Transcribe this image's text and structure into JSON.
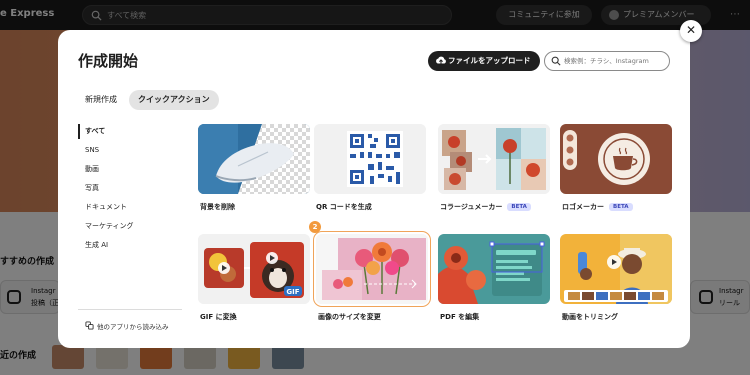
{
  "app": {
    "brand": "e Express",
    "search_placeholder": "すべて検索",
    "community_label": "コミュニティに参加",
    "premium_label": "プレミアムメンバー",
    "section_recommended": "すすめの作成",
    "section_recent": "近の作成",
    "bg_card_left": {
      "line1": "Instagr",
      "line2": "投稿（正"
    },
    "bg_card_right": {
      "line1": "Instagr",
      "line2": "リール"
    }
  },
  "modal": {
    "title": "作成開始",
    "upload_label": "ファイルをアップロード",
    "search_placeholder": "検索例：チラシ、Instagram",
    "close_symbol": "✕",
    "tabs": [
      {
        "label": "新規作成",
        "active": false
      },
      {
        "label": "クイックアクション",
        "active": true
      }
    ],
    "categories": [
      {
        "label": "すべて",
        "active": true
      },
      {
        "label": "SNS",
        "active": false
      },
      {
        "label": "動画",
        "active": false
      },
      {
        "label": "写真",
        "active": false
      },
      {
        "label": "ドキュメント",
        "active": false
      },
      {
        "label": "マーケティング",
        "active": false
      },
      {
        "label": "生成 AI",
        "active": false
      }
    ],
    "other_apps_label": "他のアプリから読み込み",
    "step_badge": "2",
    "actions": [
      {
        "label": "背景を削除",
        "icon": "remove-background-icon"
      },
      {
        "label": "QR コードを生成",
        "icon": "qr-code-icon"
      },
      {
        "label": "コラージュメーカー",
        "badge": "BETA",
        "icon": "collage-icon"
      },
      {
        "label": "ロゴメーカー",
        "badge": "BETA",
        "icon": "logo-icon"
      },
      {
        "label": "GIF に変換",
        "icon": "gif-icon",
        "thumb_text": "GIF"
      },
      {
        "label": "画像のサイズを変更",
        "icon": "resize-icon"
      },
      {
        "label": "PDF を編集",
        "icon": "pdf-icon"
      },
      {
        "label": "動画をトリミング",
        "icon": "video-trim-icon"
      }
    ]
  },
  "colors": {
    "accent_focus": "#f0a45a",
    "beta_bg": "#d9ddff",
    "dark_button": "#1f1f1f"
  }
}
